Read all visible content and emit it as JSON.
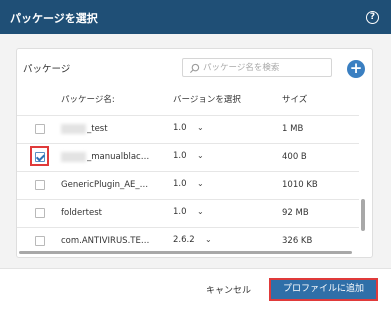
{
  "dialog": {
    "title": "パッケージを選択",
    "help_icon": "question-circle-icon"
  },
  "panel": {
    "title": "パッケージ",
    "search_placeholder": "パッケージ名を検索",
    "add_icon": "plus-circle-icon"
  },
  "columns": {
    "name": "パッケージ名:",
    "version": "バージョンを選択",
    "size": "サイズ"
  },
  "rows": [
    {
      "name": "_test",
      "version": "1.0",
      "size": "1 MB",
      "checked": false
    },
    {
      "name": "_manualblac…",
      "version": "1.0",
      "size": "400 B",
      "checked": true
    },
    {
      "name": "GenericPlugin_AE_…",
      "version": "1.0",
      "size": "1010 KB",
      "checked": false
    },
    {
      "name": "foldertest",
      "version": "1.0",
      "size": "92 MB",
      "checked": false
    },
    {
      "name": "com.ANTIVIRUS.TE…",
      "version": "2.6.2",
      "size": "326 KB",
      "checked": false
    }
  ],
  "footer": {
    "cancel_label": "キャンセル",
    "add_label": "プロファイルに追加"
  },
  "colors": {
    "header": "#1f4f76",
    "primary_button": "#2f6fa8",
    "highlight": "#e03a3a"
  }
}
